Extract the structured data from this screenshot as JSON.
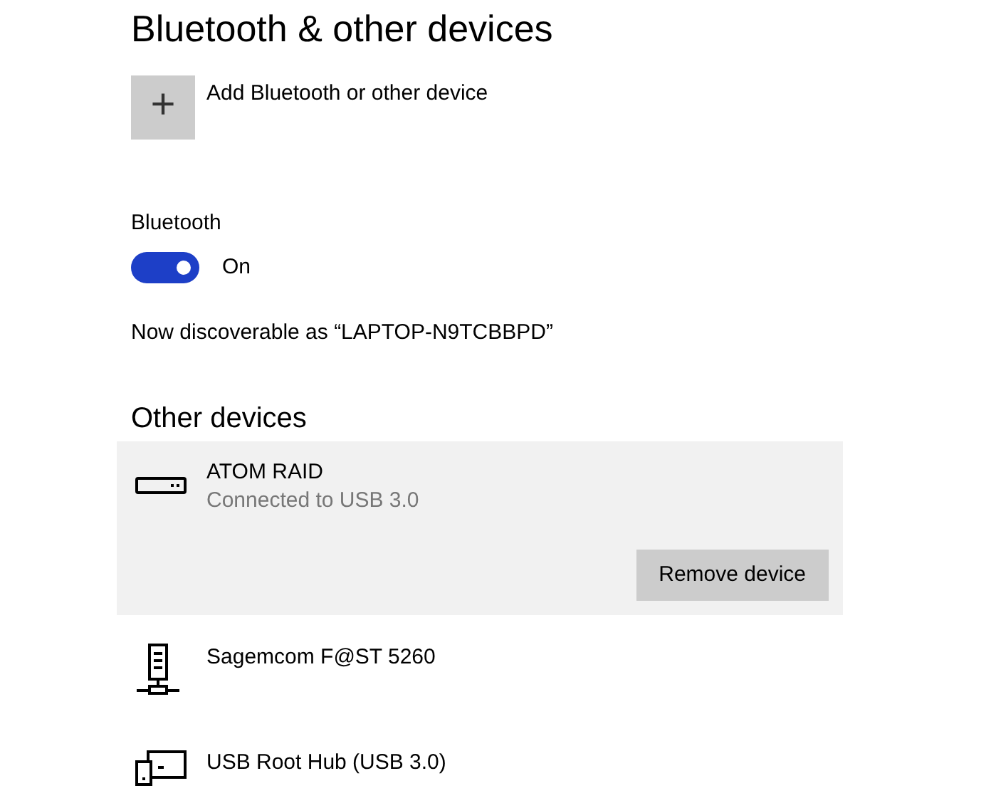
{
  "title": "Bluetooth & other devices",
  "add_device": {
    "icon": "+",
    "label": "Add Bluetooth or other device"
  },
  "bluetooth": {
    "label": "Bluetooth",
    "on": true,
    "state_text": "On"
  },
  "discoverable_text": "Now discoverable as “LAPTOP-N9TCBBPD”",
  "other_devices": {
    "heading": "Other devices",
    "devices": [
      {
        "kind": "drive",
        "name": "ATOM RAID",
        "status": "Connected to USB 3.0",
        "selected": true,
        "action": "Remove device"
      },
      {
        "kind": "server",
        "name": "Sagemcom F@ST 5260",
        "selected": false
      },
      {
        "kind": "hub",
        "name": "USB Root Hub (USB 3.0)",
        "selected": false
      }
    ]
  }
}
